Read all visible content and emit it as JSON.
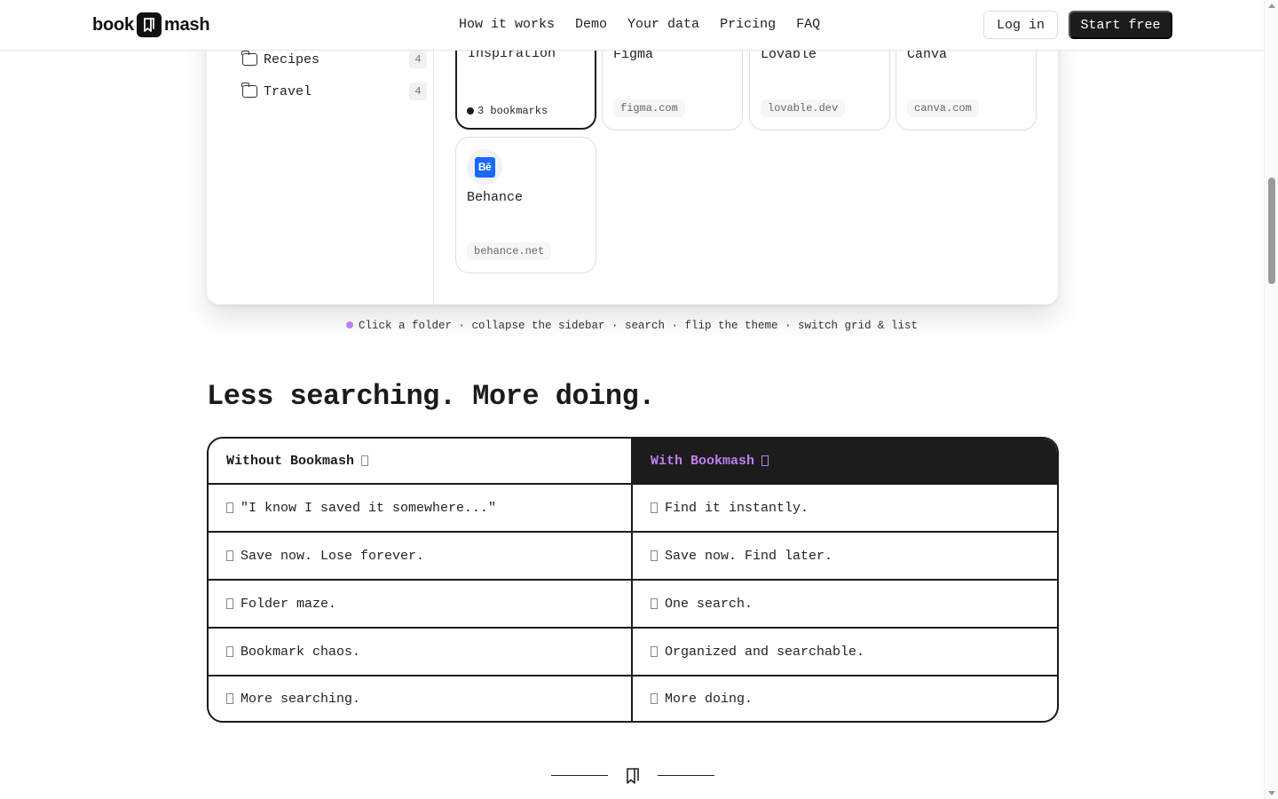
{
  "header": {
    "logo_left": "book",
    "logo_right": "mash",
    "nav": [
      "How it works",
      "Demo",
      "Your data",
      "Pricing",
      "FAQ"
    ],
    "login": "Log in",
    "start": "Start free"
  },
  "demo": {
    "folders": [
      {
        "label": "Recipes",
        "count": "4"
      },
      {
        "label": "Travel",
        "count": "4"
      }
    ],
    "cards_row1": [
      {
        "title": "Inspiration",
        "meta": "3 bookmarks",
        "selected": true
      },
      {
        "title": "Figma",
        "domain": "figma.com"
      },
      {
        "title": "Lovable",
        "domain": "lovable.dev"
      },
      {
        "title": "Canva",
        "domain": "canva.com"
      }
    ],
    "behance": {
      "title": "Behance",
      "domain": "behance.net",
      "favicon_text": "Bē"
    },
    "hint": "Click a folder · collapse the sidebar · search · flip the theme · switch grid & list"
  },
  "compare": {
    "title": "Less searching. More doing.",
    "head_left": "Without Bookmash",
    "head_right": "With Bookmash",
    "rows": [
      {
        "left": "\"I know I saved it somewhere...\"",
        "right": "Find it instantly."
      },
      {
        "left": "Save now. Lose forever.",
        "right": "Save now. Find later."
      },
      {
        "left": "Folder maze.",
        "right": "One search."
      },
      {
        "left": "Bookmark chaos.",
        "right": "Organized and searchable."
      },
      {
        "left": "More searching.",
        "right": "More doing."
      }
    ]
  },
  "colors": {
    "accent": "#c07ef0",
    "dark": "#1c1c1c",
    "behance": "#1769ff"
  }
}
